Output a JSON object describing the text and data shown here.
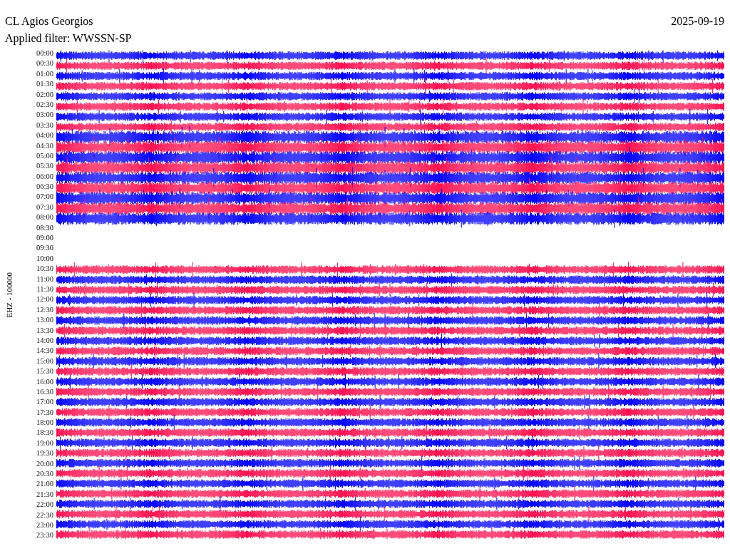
{
  "title": "CL Agios Georgios",
  "date": "2025-09-19",
  "filter": "Applied filter: WWSSN-SP",
  "channel_label": "EHZ - 100000",
  "rows": [
    {
      "time": "00:00",
      "color": "#0000ff",
      "empty": false
    },
    {
      "time": "00:30",
      "color": "#ff1050",
      "empty": false
    },
    {
      "time": "01:00",
      "color": "#0000ff",
      "empty": false
    },
    {
      "time": "01:30",
      "color": "#ff1050",
      "empty": false
    },
    {
      "time": "02:00",
      "color": "#0000ff",
      "empty": false
    },
    {
      "time": "02:30",
      "color": "#ff1050",
      "empty": false
    },
    {
      "time": "03:00",
      "color": "#0000ff",
      "empty": false
    },
    {
      "time": "03:30",
      "color": "#ff1050",
      "empty": false
    },
    {
      "time": "04:00",
      "color": "#0000ff",
      "empty": false
    },
    {
      "time": "04:30",
      "color": "#ff1050",
      "empty": false
    },
    {
      "time": "05:00",
      "color": "#0000ff",
      "empty": false
    },
    {
      "time": "05:30",
      "color": "#ff1050",
      "empty": false
    },
    {
      "time": "06:00",
      "color": "#0000ff",
      "empty": false
    },
    {
      "time": "06:30",
      "color": "#ff1050",
      "empty": false
    },
    {
      "time": "07:00",
      "color": "#0000ff",
      "empty": false
    },
    {
      "time": "07:30",
      "color": "#ff1050",
      "empty": false
    },
    {
      "time": "08:00",
      "color": "#0000ff",
      "empty": false
    },
    {
      "time": "08:30",
      "empty": true
    },
    {
      "time": "09:00",
      "empty": true
    },
    {
      "time": "09:30",
      "empty": true
    },
    {
      "time": "10:00",
      "empty": true
    },
    {
      "time": "10:30",
      "color": "#ff1050",
      "empty": false
    },
    {
      "time": "11:00",
      "color": "#0000ff",
      "empty": false
    },
    {
      "time": "11:30",
      "color": "#ff1050",
      "empty": false
    },
    {
      "time": "12:00",
      "color": "#0000ff",
      "empty": false
    },
    {
      "time": "12:30",
      "color": "#ff1050",
      "empty": false
    },
    {
      "time": "13:00",
      "color": "#0000ff",
      "empty": false
    },
    {
      "time": "13:30",
      "color": "#ff1050",
      "empty": false
    },
    {
      "time": "14:00",
      "color": "#0000ff",
      "empty": false
    },
    {
      "time": "14:30",
      "color": "#ff1050",
      "empty": false
    },
    {
      "time": "15:00",
      "color": "#0000ff",
      "empty": false
    },
    {
      "time": "15:30",
      "color": "#ff1050",
      "empty": false
    },
    {
      "time": "16:00",
      "color": "#0000ff",
      "empty": false
    },
    {
      "time": "16:30",
      "color": "#ff1050",
      "empty": false
    },
    {
      "time": "17:00",
      "color": "#0000ff",
      "empty": false
    },
    {
      "time": "17:30",
      "color": "#ff1050",
      "empty": false
    },
    {
      "time": "18:00",
      "color": "#0000ff",
      "empty": false
    },
    {
      "time": "18:30",
      "color": "#ff1050",
      "empty": false
    },
    {
      "time": "19:00",
      "color": "#0000ff",
      "empty": false
    },
    {
      "time": "19:30",
      "color": "#ff1050",
      "empty": false
    },
    {
      "time": "20:00",
      "color": "#0000ff",
      "empty": false
    },
    {
      "time": "20:30",
      "color": "#ff1050",
      "empty": false
    },
    {
      "time": "21:00",
      "color": "#0000ff",
      "empty": false
    },
    {
      "time": "21:30",
      "color": "#ff1050",
      "empty": false
    },
    {
      "time": "22:00",
      "color": "#0000ff",
      "empty": false
    },
    {
      "time": "22:30",
      "color": "#ff1050",
      "empty": false
    },
    {
      "time": "23:00",
      "color": "#0000ff",
      "empty": false
    },
    {
      "time": "23:30",
      "color": "#ff1050",
      "empty": false
    }
  ]
}
